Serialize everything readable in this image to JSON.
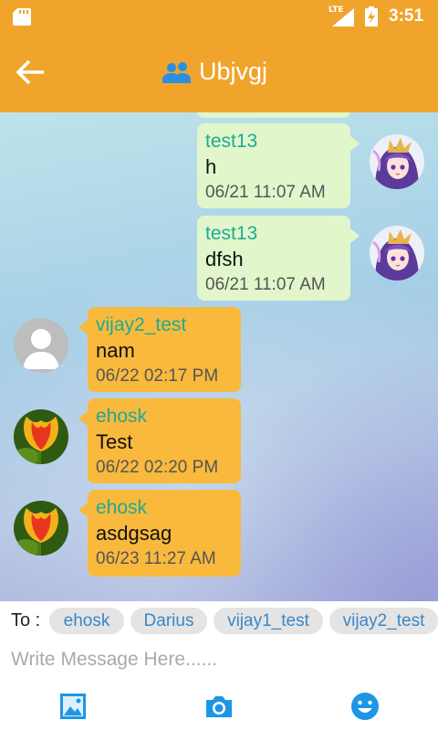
{
  "status_bar": {
    "network": "LTE",
    "time": "3:51",
    "icons": [
      "sd-card-icon",
      "signal-icon",
      "battery-charging-icon"
    ]
  },
  "app_bar": {
    "title": "Ubjvgj",
    "icons": [
      "back-arrow-icon",
      "group-icon"
    ]
  },
  "messages": [
    {
      "sender": "test13",
      "text": "h",
      "time": "06/21 11:07 AM",
      "side": "right",
      "avatar": "anime-character-avatar"
    },
    {
      "sender": "test13",
      "text": "dfsh",
      "time": "06/21 11:07 AM",
      "side": "right",
      "avatar": "anime-character-avatar"
    },
    {
      "sender": "vijay2_test",
      "text": "nam",
      "time": "06/22 02:17 PM",
      "side": "left",
      "avatar": "default-person-avatar"
    },
    {
      "sender": "ehosk",
      "text": "Test",
      "time": "06/22 02:20 PM",
      "side": "left",
      "avatar": "tulip-avatar"
    },
    {
      "sender": "ehosk",
      "text": "asdgsag",
      "time": "06/23 11:27 AM",
      "side": "left",
      "avatar": "tulip-avatar"
    }
  ],
  "recipients": {
    "label": "To :",
    "chips": [
      "ehosk",
      "Darius",
      "vijay1_test",
      "vijay2_test"
    ]
  },
  "composer": {
    "placeholder": "Write Message Here......",
    "value": ""
  },
  "toolbar": {
    "icons": [
      "image-icon",
      "camera-icon",
      "emoji-icon"
    ]
  },
  "colors": {
    "primary": "#f0a42c",
    "my_bubble": "#e1f7cb",
    "their_bubble": "#f9b93d",
    "sender_name": "#1eaa96",
    "chip_text": "#3a87c8",
    "accent_blue": "#1e96e6"
  }
}
